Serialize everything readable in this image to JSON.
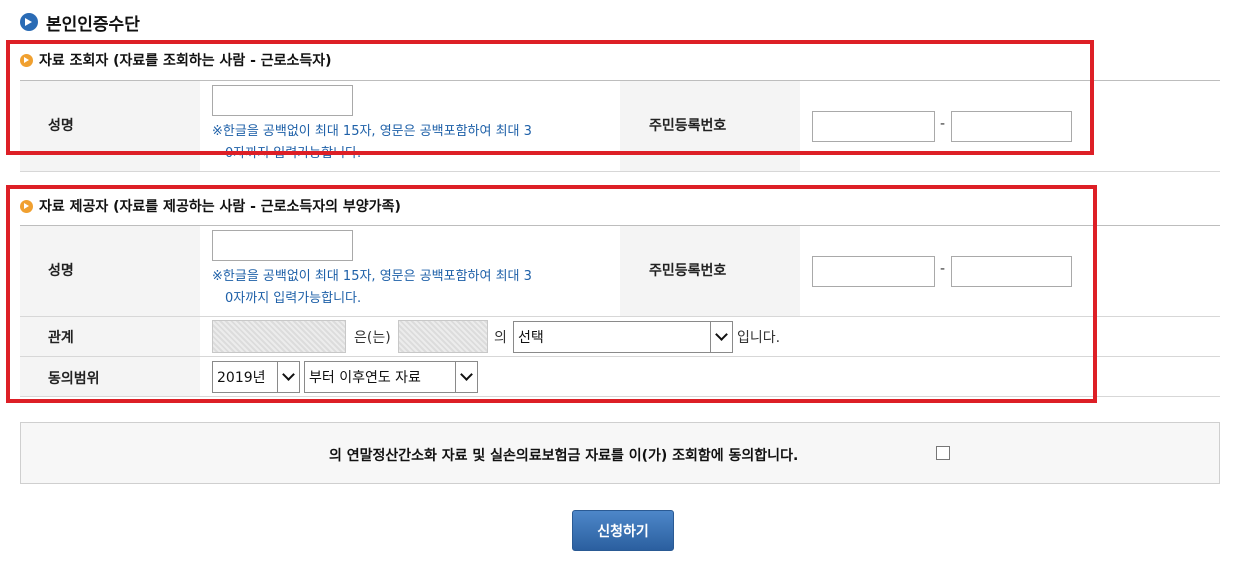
{
  "page": {
    "title": "본인인증수단"
  },
  "viewer_section": {
    "heading": "자료 조회자 (자료를 조회하는 사람 - 근로소득자)",
    "name_label": "성명",
    "name_value": "",
    "name_hint_line1": "※한글을 공백없이 최대 15자, 영문은 공백포함하여 최대 3",
    "name_hint_line2": "0자까지 입력가능합니다.",
    "rrn_label": "주민등록번호",
    "rrn_front": "",
    "rrn_back": "",
    "dash": "-"
  },
  "provider_section": {
    "heading": "자료 제공자 (자료를 제공하는 사람 - 근로소득자의 부양가족)",
    "name_label": "성명",
    "name_value": "",
    "name_hint_line1": "※한글을 공백없이 최대 15자, 영문은 공백포함하여 최대 3",
    "name_hint_line2": "0자까지 입력가능합니다.",
    "rrn_label": "주민등록번호",
    "rrn_front": "",
    "rrn_back": "",
    "dash": "-",
    "relation_label": "관계",
    "relation_text1": "은(는)",
    "relation_text2": "의",
    "relation_select": "선택",
    "relation_text3": "입니다.",
    "scope_label": "동의범위",
    "scope_year": "2019년",
    "scope_option": "부터 이후연도 자료"
  },
  "consent": {
    "text": "의 연말정산간소화 자료 및 실손의료보험금 자료를 이(가) 조회함에 동의합니다.",
    "checked": false
  },
  "actions": {
    "submit_label": "신청하기"
  },
  "colors": {
    "highlight_red": "#dd1f26",
    "hint_blue": "#1e60a8",
    "button_blue": "#2b5f9f"
  }
}
